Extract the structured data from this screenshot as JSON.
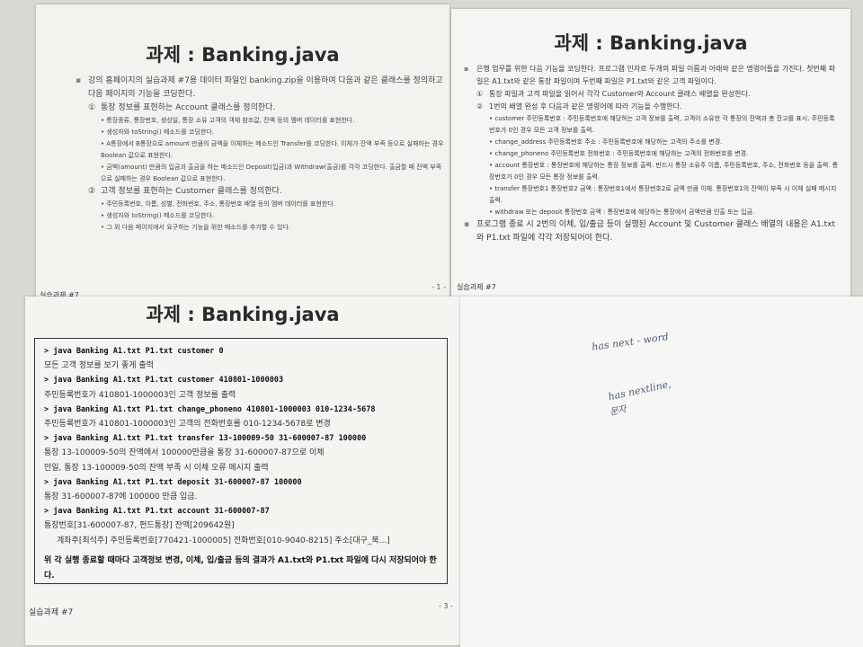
{
  "page1": {
    "title": "과제 : Banking.java",
    "intro": "강의 홈페이지의 실습과제 #7용 데이터 파일인 banking.zip을 이용하여 다음과 같은 클래스를 정의하고 다음 페이지의 기능을 코딩한다.",
    "account_heading": "통장 정보를 표현하는 Account 클래스를 정의한다.",
    "account_items": [
      "통장종류, 통장번호, 생성일, 통장 소유 고객의 객체 참조값, 잔액 등의 멤버 데이터를 표현한다.",
      "생성자와 toString() 메소드를 코딩한다.",
      "A통장에서 B통장으로 amount 만큼의 금액을 이체하는 메소드인 Transfer를 코딩한다. 이체가 잔액 부족 등으로 실패하는 경우 Boolean 값으로 표현한다.",
      "금액(amount) 만큼의 입금과 출금을 하는 메소드인 Deposit(입금)과 Withdraw(출금)를 각각 코딩한다. 출금할 때 잔액 부족으로 실패하는 경우 Boolean 값으로 표현한다."
    ],
    "customer_heading": "고객 정보를 표현하는 Customer 클래스를 정의한다.",
    "customer_items": [
      "주민등록번호, 이름, 성별, 전화번호, 주소, 통장번호 배열 등의 멤버 데이터를 표현한다.",
      "생성자와 toString() 메소드를 코딩한다.",
      "그 외 다음 페이지에서 요구하는 기능을 위한 메소드를 추가할 수 있다."
    ],
    "footer": "실습과제 #7",
    "page_no": "- 1 -"
  },
  "page2": {
    "title": "과제 : Banking.java",
    "intro": "은행 업무를 위한 다음 기능을 코딩한다. 프로그램 인자로 두개의 파일 이름과 아래와 같은 명령어들을 가진다. 첫번째 파일은 A1.txt와 같은 통장 파일이며 두번째 파일은 P1.txt와 같은 고객 파일이다.",
    "step1": "통장 파일과 고객 파일을 읽어서 각각 Customer와 Account 클래스 배열을 완성한다.",
    "step2": "1번의 배열 완성 후 다음과 같은 명령어에 따라 기능을 수행한다.",
    "commands": [
      "customer 주민등록번호 : 주민등록번호에 해당하는 고객 정보를 출력, 고객이 소유한 각 통장의 잔액과 총 잔고를 표시. 주민등록번호가 0인 경우 모든 고객 정보를 출력.",
      "change_address 주민등록번호 주소 : 주민등록번호에 해당하는 고객의 주소를 변경.",
      "change_phoneno 주민등록번호 전화번호 : 주민등록번호에 해당하는 고객의 전화번호를 변경.",
      "account 통장번호 : 통장번호에 해당하는 통장 정보를 출력. 반드시 통장 소유주 이름, 주민등록번호, 주소, 전화번호 등을 출력. 통장번호가 0인 경우 모든 통장 정보를 출력.",
      "transfer 통장번호1 통장번호2 금액 : 통장번호1에서 통장번호2로 금액 만큼 이체. 통장번호1의 잔액이 부족 시 이체 실패 메시지 출력.",
      "withdraw 또는 deposit 통장번호 금액 : 통장번호에 해당하는 통장에서 금액만큼 인출 또는 입금."
    ],
    "final_note": "프로그램 종료 시 2번의 이체, 입/출금 등이 실행된 Account 및 Customer 클래스 배열의 내용은 A1.txt와 P1.txt 파일에 각각 저장되어야 한다.",
    "footer": "실습과제 #7"
  },
  "page3": {
    "title": "과제 : Banking.java",
    "lines": [
      {
        "kind": "cmd",
        "text": "> java Banking A1.txt P1.txt customer 0"
      },
      {
        "kind": "out",
        "text": "모든 고객 정보를 보기 좋게 출력"
      },
      {
        "kind": "cmd",
        "text": "> java Banking A1.txt P1.txt customer 410801-1000003"
      },
      {
        "kind": "out",
        "text": "주민등록번호가 410801-1000003인 고객 정보를 출력"
      },
      {
        "kind": "cmd",
        "text": "> java Banking A1.txt P1.txt change_phoneno 410801-1000003 010-1234-5678"
      },
      {
        "kind": "out",
        "text": "주민등록번호가 410801-1000003인 고객의 전화번호를 010-1234-5678로 변경"
      },
      {
        "kind": "cmd",
        "text": "> java Banking A1.txt P1.txt transfer 13-100009-50 31-600007-87 100000"
      },
      {
        "kind": "out",
        "text": "통장 13-100009-50의 잔액에서 100000만큼을 통장 31-600007-87으로 이체"
      },
      {
        "kind": "out",
        "text": "만일, 통장 13-100009-50의 잔액 부족 시 이체 오류 메시지 출력"
      },
      {
        "kind": "cmd",
        "text": "> java Banking A1.txt P1.txt deposit 31-600007-87 100000"
      },
      {
        "kind": "out",
        "text": "통장 31-600007-87에 100000 만큼 입금."
      },
      {
        "kind": "cmd",
        "text": "> java Banking A1.txt P1.txt account 31-600007-87"
      },
      {
        "kind": "out",
        "text": "통장번호[31-600007-87, 펀드통장] 잔액[209642원]"
      },
      {
        "kind": "out-indent",
        "text": "계좌주[최석주] 주민등록번호[770421-1000005] 전화번호[010-9040-8215] 주소[대구_북...]"
      }
    ],
    "note": "위 각 실행 종료할 때마다 고객정보 변경, 이체, 입/출금 등의 결과가 A1.txt와 P1.txt 파일에 다시 저장되어야 한다.",
    "footer": "실습과제 #7",
    "page_no": "- 3 -"
  },
  "handwriting": {
    "line1": "has next - word",
    "line2": "has nextline,",
    "line3": "문자"
  }
}
